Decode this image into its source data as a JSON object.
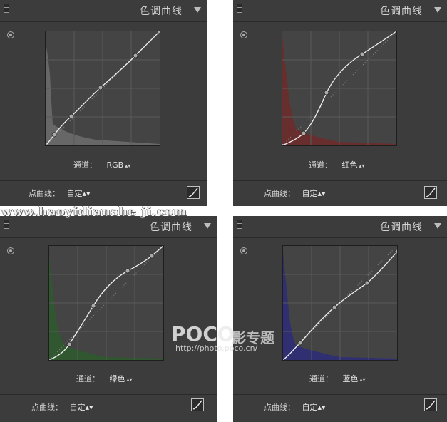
{
  "panels": [
    {
      "title": "色调曲线",
      "channel_label": "通道：",
      "channel_value": "RGB",
      "point_curve_label": "点曲线：",
      "point_curve_value": "自定"
    },
    {
      "title": "色调曲线",
      "channel_label": "通道：",
      "channel_value": "红色",
      "point_curve_label": "点曲线：",
      "point_curve_value": "自定"
    },
    {
      "title": "色调曲线",
      "channel_label": "通道：",
      "channel_value": "绿色",
      "point_curve_label": "点曲线：",
      "point_curve_value": "自定"
    },
    {
      "title": "色调曲线",
      "channel_label": "通道：",
      "channel_value": "蓝色",
      "point_curve_label": "点曲线：",
      "point_curve_value": "自定"
    }
  ],
  "watermark": {
    "url_text": "www.haoyidianshe ji.com",
    "brand": "POCO",
    "brand_cn": "影专题",
    "brand_url": "http://photo.poco.cn/"
  },
  "colors": {
    "panel_bg": "#3c3c3c",
    "graph_bg": "#444444",
    "rgb_hist": "#6e6e6e",
    "red_hist": "#7a2a2a",
    "green_hist": "#2d5a2d",
    "blue_hist": "#2c2c7a"
  },
  "icons": {
    "collapse": "collapse-square-icon",
    "menu": "triangle-down-icon",
    "target": "target-adjust-icon",
    "edit": "edit-point-curve-icon"
  }
}
